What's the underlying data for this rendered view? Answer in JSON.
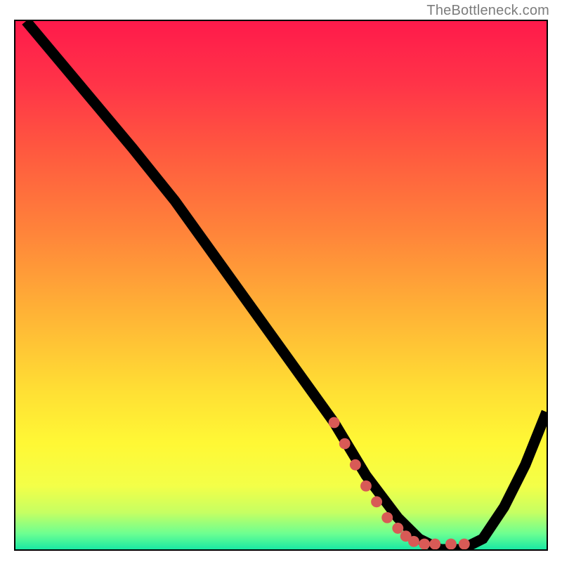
{
  "watermark": "TheBottleneck.com",
  "gradient_stops": [
    {
      "offset": 0.0,
      "color": "#ff1a4b"
    },
    {
      "offset": 0.12,
      "color": "#ff3448"
    },
    {
      "offset": 0.25,
      "color": "#ff5a3f"
    },
    {
      "offset": 0.4,
      "color": "#ff843a"
    },
    {
      "offset": 0.55,
      "color": "#ffb236"
    },
    {
      "offset": 0.7,
      "color": "#ffdf34"
    },
    {
      "offset": 0.8,
      "color": "#fff835"
    },
    {
      "offset": 0.88,
      "color": "#f3ff48"
    },
    {
      "offset": 0.93,
      "color": "#c6ff62"
    },
    {
      "offset": 0.97,
      "color": "#6dff91"
    },
    {
      "offset": 1.0,
      "color": "#19e8a3"
    }
  ],
  "chart_data": {
    "type": "line",
    "title": "",
    "xlabel": "",
    "ylabel": "",
    "xlim": [
      0,
      100
    ],
    "ylim": [
      0,
      100
    ],
    "series": [
      {
        "name": "bottleneck-curve",
        "x": [
          2,
          12,
          22,
          30,
          40,
          50,
          60,
          66,
          72,
          76,
          80,
          84,
          88,
          92,
          96,
          100
        ],
        "y": [
          100,
          88,
          76,
          66,
          52,
          38,
          24,
          14,
          6,
          2,
          0,
          0,
          2,
          8,
          16,
          26
        ]
      }
    ],
    "markers": {
      "name": "highlight-segment",
      "color": "#d85a56",
      "points": [
        {
          "x": 60,
          "y": 24
        },
        {
          "x": 62,
          "y": 20
        },
        {
          "x": 64,
          "y": 16
        },
        {
          "x": 66,
          "y": 12
        },
        {
          "x": 68,
          "y": 9
        },
        {
          "x": 70,
          "y": 6
        },
        {
          "x": 72,
          "y": 4
        },
        {
          "x": 73.5,
          "y": 2.5
        },
        {
          "x": 75,
          "y": 1.5
        },
        {
          "x": 77,
          "y": 1
        },
        {
          "x": 79,
          "y": 1
        },
        {
          "x": 82,
          "y": 1
        },
        {
          "x": 84.5,
          "y": 1
        }
      ]
    }
  }
}
